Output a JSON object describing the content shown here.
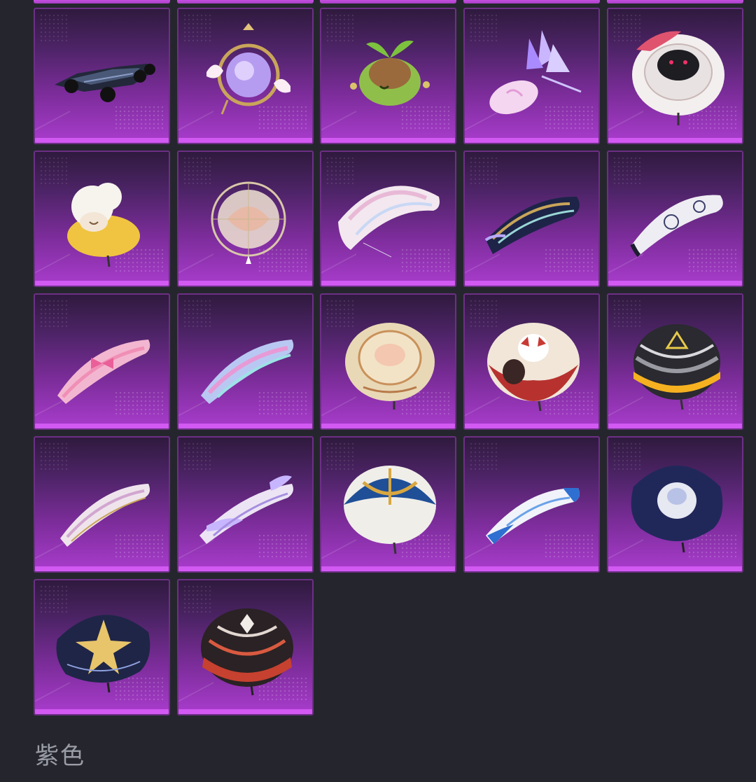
{
  "section": {
    "label": "紫色"
  },
  "items": [
    {
      "icon": "race-car-icon"
    },
    {
      "icon": "winged-mirror-icon"
    },
    {
      "icon": "sprout-creature-icon"
    },
    {
      "icon": "crystal-candy-icon"
    },
    {
      "icon": "cat-umbrella-icon"
    },
    {
      "icon": "sheep-cloud-icon"
    },
    {
      "icon": "dreamcatcher-icon"
    },
    {
      "icon": "pastel-parachute-icon"
    },
    {
      "icon": "ornate-glider-icon"
    },
    {
      "icon": "white-swirl-parachute-icon"
    },
    {
      "icon": "pink-bow-parachute-icon"
    },
    {
      "icon": "pastel-pattern-parachute-icon"
    },
    {
      "icon": "beige-dome-parachute-icon"
    },
    {
      "icon": "red-character-parachute-icon"
    },
    {
      "icon": "yellow-striped-parachute-icon"
    },
    {
      "icon": "white-gold-glider-icon"
    },
    {
      "icon": "winged-glider-icon"
    },
    {
      "icon": "blue-gold-dome-parachute-icon"
    },
    {
      "icon": "blue-white-parachute-icon"
    },
    {
      "icon": "navy-square-parachute-icon"
    },
    {
      "icon": "navy-star-parachute-icon"
    },
    {
      "icon": "red-striped-dome-parachute-icon"
    }
  ],
  "colors": {
    "background": "#25262d",
    "tile_top": "#2f1a3e",
    "tile_bottom": "#a93ccd",
    "tile_bottom_bar": "#d259f2",
    "label": "#9a9ca6"
  }
}
